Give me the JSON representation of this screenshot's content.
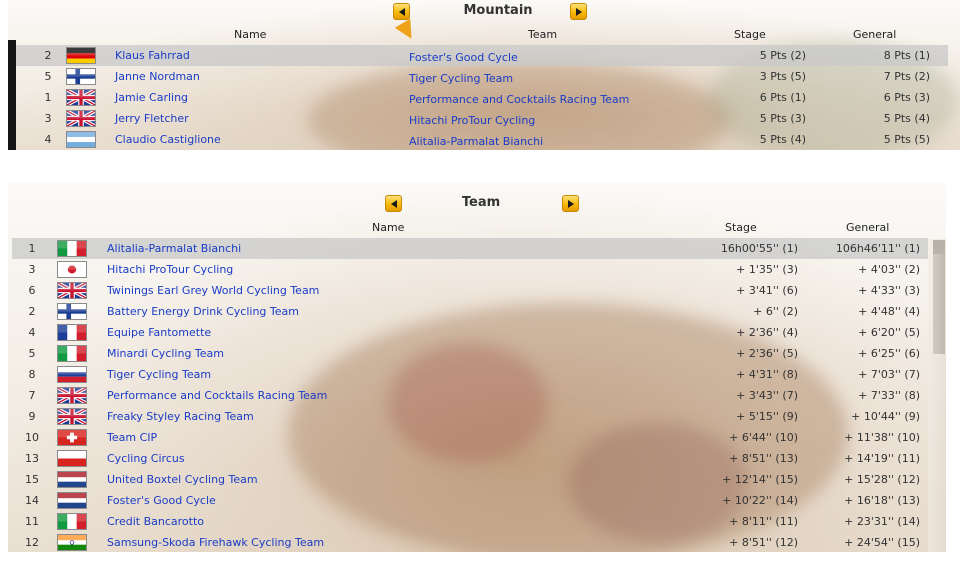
{
  "mountain": {
    "title": "Mountain",
    "columns": {
      "name": "Name",
      "team": "Team",
      "stage": "Stage",
      "general": "General"
    },
    "rows": [
      {
        "rank": "2",
        "flag": "germany-flag",
        "name": "Klaus Fahrrad",
        "team": "Foster's Good Cycle",
        "stage": "5 Pts (2)",
        "general": "8 Pts (1)"
      },
      {
        "rank": "5",
        "flag": "finland-flag",
        "name": "Janne Nordman",
        "team": "Tiger Cycling Team",
        "stage": "3 Pts (5)",
        "general": "7 Pts (2)"
      },
      {
        "rank": "1",
        "flag": "uk-flag",
        "name": "Jamie Carling",
        "team": "Performance and Cocktails Racing Team",
        "stage": "6 Pts (1)",
        "general": "6 Pts (3)"
      },
      {
        "rank": "3",
        "flag": "uk-flag",
        "name": "Jerry Fletcher",
        "team": "Hitachi ProTour Cycling",
        "stage": "5 Pts (3)",
        "general": "5 Pts (4)"
      },
      {
        "rank": "4",
        "flag": "argentina-flag",
        "name": "Claudio Castiglione",
        "team": "Alitalia-Parmalat Bianchi",
        "stage": "5 Pts (4)",
        "general": "5 Pts (5)"
      }
    ]
  },
  "team": {
    "title": "Team",
    "columns": {
      "name": "Name",
      "stage": "Stage",
      "general": "General"
    },
    "rows": [
      {
        "rank": "1",
        "flag": "italy-flag",
        "name": "Alitalia-Parmalat Bianchi",
        "stage": "16h00'55'' (1)",
        "general": "106h46'11'' (1)"
      },
      {
        "rank": "3",
        "flag": "japan-flag",
        "name": "Hitachi ProTour Cycling",
        "stage": "+ 1'35'' (3)",
        "general": "+ 4'03'' (2)"
      },
      {
        "rank": "6",
        "flag": "uk-flag",
        "name": "Twinings Earl Grey World Cycling Team",
        "stage": "+ 3'41'' (6)",
        "general": "+ 4'33'' (3)"
      },
      {
        "rank": "2",
        "flag": "finland-flag",
        "name": "Battery Energy Drink Cycling Team",
        "stage": "+ 6'' (2)",
        "general": "+ 4'48'' (4)"
      },
      {
        "rank": "4",
        "flag": "france-flag",
        "name": "Equipe Fantomette",
        "stage": "+ 2'36'' (4)",
        "general": "+ 6'20'' (5)"
      },
      {
        "rank": "5",
        "flag": "italy-flag",
        "name": "Minardi Cycling Team",
        "stage": "+ 2'36'' (5)",
        "general": "+ 6'25'' (6)"
      },
      {
        "rank": "8",
        "flag": "russia-flag",
        "name": "Tiger Cycling Team",
        "stage": "+ 4'31'' (8)",
        "general": "+ 7'03'' (7)"
      },
      {
        "rank": "7",
        "flag": "uk-flag",
        "name": "Performance and Cocktails Racing Team",
        "stage": "+ 3'43'' (7)",
        "general": "+ 7'33'' (8)"
      },
      {
        "rank": "9",
        "flag": "uk-flag",
        "name": "Freaky Styley Racing Team",
        "stage": "+ 5'15'' (9)",
        "general": "+ 10'44'' (9)"
      },
      {
        "rank": "10",
        "flag": "switzerland-flag",
        "name": "Team CIP",
        "stage": "+ 6'44'' (10)",
        "general": "+ 11'38'' (10)"
      },
      {
        "rank": "13",
        "flag": "poland-flag",
        "name": "Cycling Circus",
        "stage": "+ 8'51'' (13)",
        "general": "+ 14'19'' (11)"
      },
      {
        "rank": "15",
        "flag": "netherlands-flag",
        "name": "United Boxtel Cycling Team",
        "stage": "+ 12'14'' (15)",
        "general": "+ 15'28'' (12)"
      },
      {
        "rank": "14",
        "flag": "netherlands-flag",
        "name": "Foster's Good Cycle",
        "stage": "+ 10'22'' (14)",
        "general": "+ 16'18'' (13)"
      },
      {
        "rank": "11",
        "flag": "italy-flag",
        "name": "Credit Bancarotto",
        "stage": "+ 8'11'' (11)",
        "general": "+ 23'31'' (14)"
      },
      {
        "rank": "12",
        "flag": "india-flag",
        "name": "Samsung-Skoda Firehawk Cycling Team",
        "stage": "+ 8'51'' (12)",
        "general": "+ 24'54'' (15)"
      }
    ]
  },
  "colors": {
    "link": "#1a3cc7",
    "nav_button": "#f7b90b",
    "selected_row": "#c8c8c8"
  },
  "icons": {
    "prev": "left-arrow-icon",
    "next": "right-arrow-icon"
  }
}
